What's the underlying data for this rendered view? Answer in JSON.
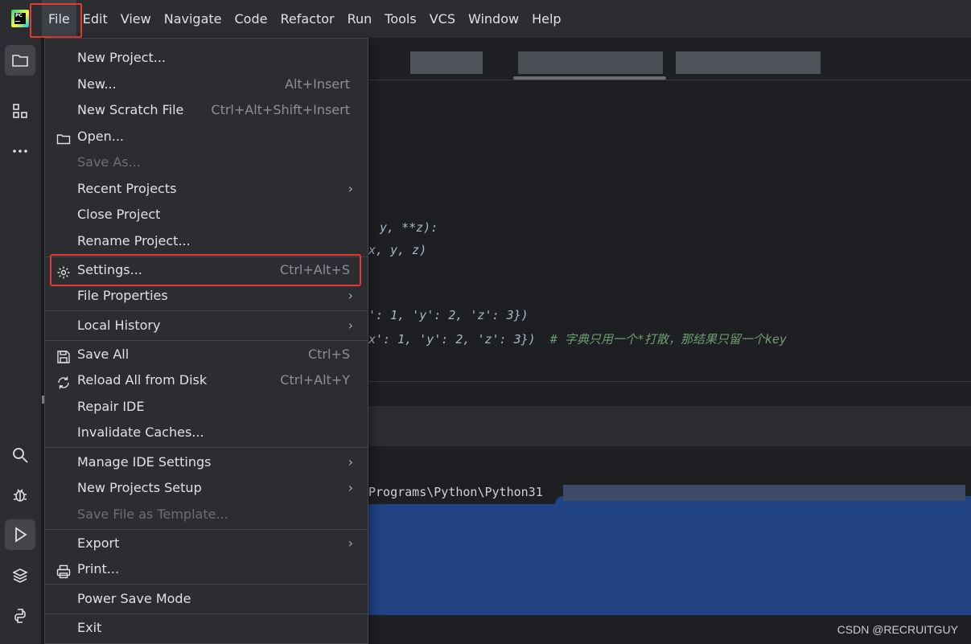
{
  "menubar": {
    "logo_label": "PC",
    "items": [
      "File",
      "Edit",
      "View",
      "Navigate",
      "Code",
      "Refactor",
      "Run",
      "Tools",
      "VCS",
      "Window",
      "Help"
    ]
  },
  "toolstrip": {
    "top": [
      "folder-icon",
      "structure-icon",
      "more-icon"
    ],
    "bottom": [
      "search-icon",
      "debug-icon",
      "run-icon",
      "layers-icon",
      "python-icon"
    ]
  },
  "editor": {
    "code_lines": [
      "y, **z):",
      "x, y, z)",
      "': 1, 'y': 2, 'z': 3})",
      "x': 1, 'y': 2, 'z': 3})"
    ],
    "comment": "# 字典只用一个*打散，那结果只留一个key"
  },
  "console": {
    "path_line": "Programs\\Python\\Python31"
  },
  "file_menu": {
    "items": [
      {
        "label": "New Project...",
        "shortcut": "",
        "icon": "",
        "submenu": false,
        "disabled": false
      },
      {
        "label": "New...",
        "shortcut": "Alt+Insert",
        "icon": "",
        "submenu": false,
        "disabled": false
      },
      {
        "label": "New Scratch File",
        "shortcut": "Ctrl+Alt+Shift+Insert",
        "icon": "",
        "submenu": false,
        "disabled": false
      },
      {
        "label": "Open...",
        "shortcut": "",
        "icon": "folder-icon",
        "submenu": false,
        "disabled": false
      },
      {
        "label": "Save As...",
        "shortcut": "",
        "icon": "",
        "submenu": false,
        "disabled": true
      },
      {
        "label": "Recent Projects",
        "shortcut": "",
        "icon": "",
        "submenu": true,
        "disabled": false
      },
      {
        "label": "Close Project",
        "shortcut": "",
        "icon": "",
        "submenu": false,
        "disabled": false
      },
      {
        "label": "Rename Project...",
        "shortcut": "",
        "icon": "",
        "submenu": false,
        "disabled": false
      },
      {
        "label": "Settings...",
        "shortcut": "Ctrl+Alt+S",
        "icon": "gear-icon",
        "submenu": false,
        "disabled": false
      },
      {
        "label": "File Properties",
        "shortcut": "",
        "icon": "",
        "submenu": true,
        "disabled": false
      },
      {
        "label": "Local History",
        "shortcut": "",
        "icon": "",
        "submenu": true,
        "disabled": false
      },
      {
        "label": "Save All",
        "shortcut": "Ctrl+S",
        "icon": "save-icon",
        "submenu": false,
        "disabled": false
      },
      {
        "label": "Reload All from Disk",
        "shortcut": "Ctrl+Alt+Y",
        "icon": "reload-icon",
        "submenu": false,
        "disabled": false
      },
      {
        "label": "Repair IDE",
        "shortcut": "",
        "icon": "",
        "submenu": false,
        "disabled": false
      },
      {
        "label": "Invalidate Caches...",
        "shortcut": "",
        "icon": "",
        "submenu": false,
        "disabled": false
      },
      {
        "label": "Manage IDE Settings",
        "shortcut": "",
        "icon": "",
        "submenu": true,
        "disabled": false
      },
      {
        "label": "New Projects Setup",
        "shortcut": "",
        "icon": "",
        "submenu": true,
        "disabled": false
      },
      {
        "label": "Save File as Template...",
        "shortcut": "",
        "icon": "",
        "submenu": false,
        "disabled": true
      },
      {
        "label": "Export",
        "shortcut": "",
        "icon": "",
        "submenu": true,
        "disabled": false
      },
      {
        "label": "Print...",
        "shortcut": "",
        "icon": "print-icon",
        "submenu": false,
        "disabled": false
      },
      {
        "label": "Power Save Mode",
        "shortcut": "",
        "icon": "",
        "submenu": false,
        "disabled": false
      },
      {
        "label": "Exit",
        "shortcut": "",
        "icon": "",
        "submenu": false,
        "disabled": false
      }
    ],
    "submenu_arrow": "›"
  },
  "watermark": "CSDN @RECRUITGUY",
  "colors": {
    "highlight_border": "#e53935",
    "selection": "#214283",
    "comment": "#6f9b74"
  }
}
